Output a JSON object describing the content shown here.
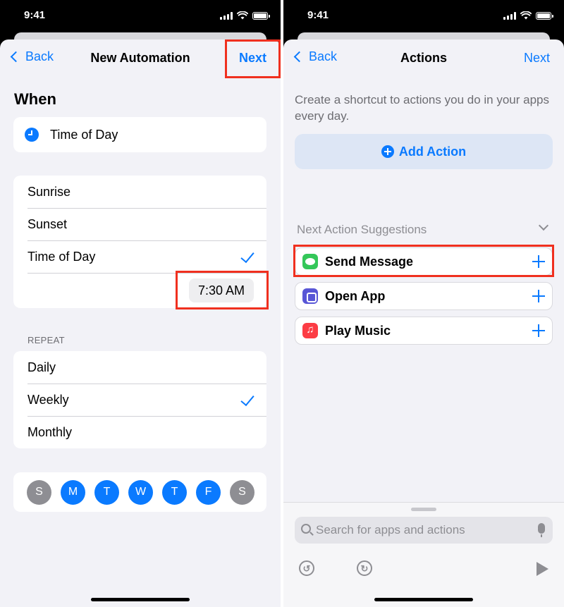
{
  "status_bar": {
    "time": "9:41"
  },
  "left_screen": {
    "nav": {
      "back_label": "Back",
      "title": "New Automation",
      "next_label": "Next"
    },
    "when_heading": "When",
    "trigger": {
      "icon": "clock-icon",
      "label": "Time of Day"
    },
    "time_options": [
      {
        "label": "Sunrise",
        "selected": false
      },
      {
        "label": "Sunset",
        "selected": false
      },
      {
        "label": "Time of Day",
        "selected": true
      }
    ],
    "time_value": "7:30 AM",
    "repeat_heading": "REPEAT",
    "repeat_options": [
      {
        "label": "Daily",
        "selected": false
      },
      {
        "label": "Weekly",
        "selected": true
      },
      {
        "label": "Monthly",
        "selected": false
      }
    ],
    "days": [
      {
        "label": "S",
        "selected": false
      },
      {
        "label": "M",
        "selected": true
      },
      {
        "label": "T",
        "selected": true
      },
      {
        "label": "W",
        "selected": true
      },
      {
        "label": "T",
        "selected": true
      },
      {
        "label": "F",
        "selected": true
      },
      {
        "label": "S",
        "selected": false
      }
    ]
  },
  "right_screen": {
    "nav": {
      "back_label": "Back",
      "title": "Actions",
      "next_label": "Next"
    },
    "intro_text": "Create a shortcut to actions you do in your apps every day.",
    "add_action_label": "Add Action",
    "suggestions_heading": "Next Action Suggestions",
    "suggestions": [
      {
        "label": "Send Message",
        "icon": "messages-icon"
      },
      {
        "label": "Open App",
        "icon": "open-app-icon"
      },
      {
        "label": "Play Music",
        "icon": "music-icon"
      }
    ],
    "search_placeholder": "Search for apps and actions"
  },
  "colors": {
    "accent": "#0a7aff",
    "highlight": "#f0301f",
    "background": "#f2f2f7"
  }
}
